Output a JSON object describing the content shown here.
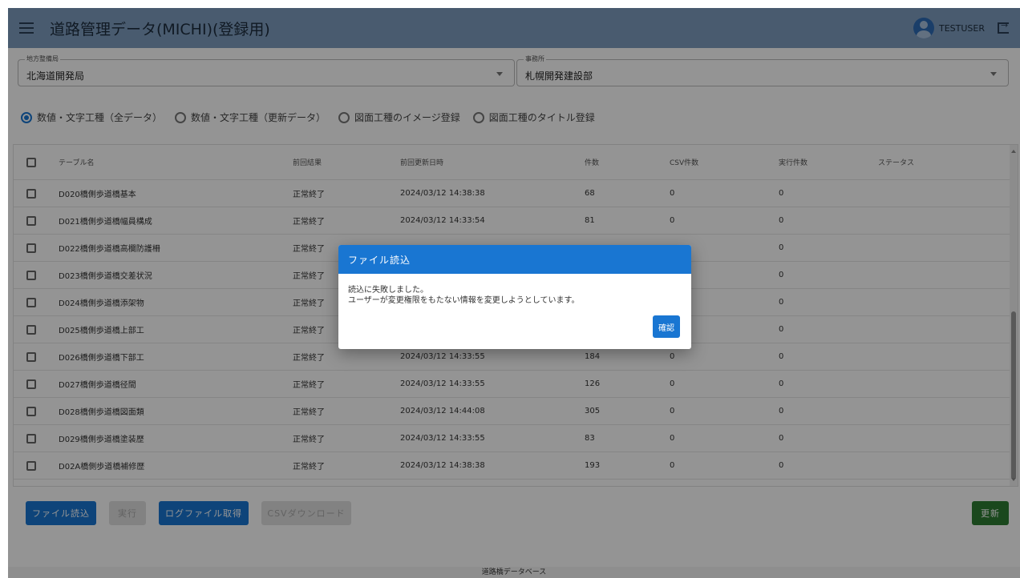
{
  "app": {
    "title": "道路管理データ(MICHI)(登録用)",
    "username": "TESTUSER"
  },
  "filters": {
    "bureau": {
      "label": "地方整備局",
      "value": "北海道開発局"
    },
    "office": {
      "label": "事務所",
      "value": "札幌開発建設部"
    }
  },
  "radios": [
    {
      "label": "数値・文字工種（全データ）",
      "selected": true
    },
    {
      "label": "数値・文字工種（更新データ）",
      "selected": false
    },
    {
      "label": "図面工種のイメージ登録",
      "selected": false
    },
    {
      "label": "図面工種のタイトル登録",
      "selected": false
    }
  ],
  "table": {
    "headers": {
      "name": "テーブル名",
      "prev_result": "前回結果",
      "prev_updated": "前回更新日時",
      "count": "件数",
      "csv_count": "CSV件数",
      "exec_count": "実行件数",
      "status": "ステータス"
    },
    "rows": [
      {
        "name": "D020橋側歩道橋基本",
        "prev_result": "正常終了",
        "prev_updated": "2024/03/12 14:38:38",
        "count": "68",
        "csv_count": "0",
        "exec_count": "0",
        "status": ""
      },
      {
        "name": "D021橋側歩道橋幅員構成",
        "prev_result": "正常終了",
        "prev_updated": "2024/03/12 14:33:54",
        "count": "81",
        "csv_count": "0",
        "exec_count": "0",
        "status": ""
      },
      {
        "name": "D022橋側歩道橋高欄防護柵",
        "prev_result": "正常終了",
        "prev_updated": "",
        "count": "",
        "csv_count": "",
        "exec_count": "0",
        "status": ""
      },
      {
        "name": "D023橋側歩道橋交差状況",
        "prev_result": "正常終了",
        "prev_updated": "",
        "count": "",
        "csv_count": "",
        "exec_count": "0",
        "status": ""
      },
      {
        "name": "D024橋側歩道橋添架物",
        "prev_result": "正常終了",
        "prev_updated": "",
        "count": "",
        "csv_count": "",
        "exec_count": "0",
        "status": ""
      },
      {
        "name": "D025橋側歩道橋上部工",
        "prev_result": "正常終了",
        "prev_updated": "",
        "count": "",
        "csv_count": "",
        "exec_count": "0",
        "status": ""
      },
      {
        "name": "D026橋側歩道橋下部工",
        "prev_result": "正常終了",
        "prev_updated": "2024/03/12 14:33:55",
        "count": "184",
        "csv_count": "0",
        "exec_count": "0",
        "status": ""
      },
      {
        "name": "D027橋側歩道橋径間",
        "prev_result": "正常終了",
        "prev_updated": "2024/03/12 14:33:55",
        "count": "126",
        "csv_count": "0",
        "exec_count": "0",
        "status": ""
      },
      {
        "name": "D028橋側歩道橋図面類",
        "prev_result": "正常終了",
        "prev_updated": "2024/03/12 14:44:08",
        "count": "305",
        "csv_count": "0",
        "exec_count": "0",
        "status": ""
      },
      {
        "name": "D029橋側歩道橋塗装歴",
        "prev_result": "正常終了",
        "prev_updated": "2024/03/12 14:33:55",
        "count": "83",
        "csv_count": "0",
        "exec_count": "0",
        "status": ""
      },
      {
        "name": "D02A橋側歩道橋補修歴",
        "prev_result": "正常終了",
        "prev_updated": "2024/03/12 14:38:38",
        "count": "193",
        "csv_count": "0",
        "exec_count": "0",
        "status": ""
      }
    ]
  },
  "buttons": {
    "file_load": "ファイル読込",
    "execute": "実行",
    "log_file": "ログファイル取得",
    "csv_download": "CSVダウンロード",
    "refresh": "更新"
  },
  "footer": {
    "text": "道路橋データベース"
  },
  "dialog": {
    "title": "ファイル読込",
    "message_line1": "読込に失敗しました。",
    "message_line2": "ユーザーが変更権限をもたない情報を変更しようとしています。",
    "ok_label": "確認"
  },
  "colors": {
    "appbar": "#7f9ec0",
    "primary": "#1976d2",
    "success": "#2e7d32",
    "disabled": "#e0e0e0"
  }
}
